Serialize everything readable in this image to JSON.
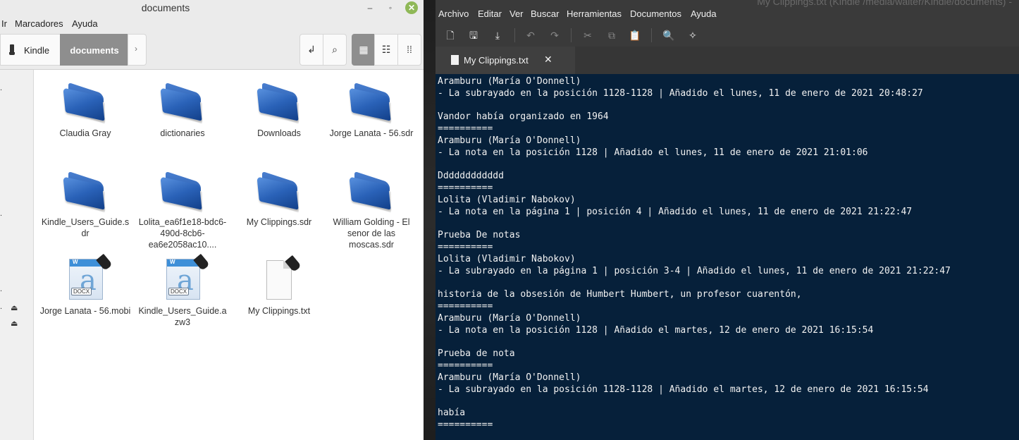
{
  "file_manager": {
    "window_title": "documents",
    "window_controls": {
      "minimize": "‒",
      "maximize": "◦",
      "close": "✕"
    },
    "menu": [
      "Ir",
      "Marcadores",
      "Ayuda"
    ],
    "breadcrumb": {
      "device": "Kindle",
      "current": "documents",
      "next": "›"
    },
    "toolbar": {
      "path_toggle": "↲",
      "search": "⌕",
      "view_icons": "▦",
      "view_compact": "☷",
      "view_list": "⁞⁞"
    },
    "sidebar_marks": [
      ".",
      ".",
      ".",
      ".",
      "⏏",
      "⏏"
    ],
    "files": [
      {
        "name": "Claudia Gray",
        "type": "folder"
      },
      {
        "name": "dictionaries",
        "type": "folder"
      },
      {
        "name": "Downloads",
        "type": "folder"
      },
      {
        "name": "Jorge Lanata - 56.sdr",
        "type": "folder"
      },
      {
        "name": "Kindle_Users_Guide.sdr",
        "type": "folder"
      },
      {
        "name": "Lolita_ea6f1e18-bdc6-490d-8cb6-ea6e2058ac10....",
        "type": "folder"
      },
      {
        "name": "My Clippings.sdr",
        "type": "folder"
      },
      {
        "name": "William Golding - El senor de las moscas.sdr",
        "type": "folder"
      },
      {
        "name": "Jorge Lanata - 56.mobi",
        "type": "word"
      },
      {
        "name": "Kindle_Users_Guide.azw3",
        "type": "word"
      },
      {
        "name": "My Clippings.txt",
        "type": "text"
      }
    ],
    "word_icon": {
      "letter": "a",
      "header": "W",
      "badge": "DOCX"
    }
  },
  "editor": {
    "window_title": "My Clippings.txt (Kindle /media/walter/Kindle/documents) -",
    "menu": [
      "Archivo",
      "Editar",
      "Ver",
      "Buscar",
      "Herramientas",
      "Documentos",
      "Ayuda"
    ],
    "toolbar_icons": [
      "new-document-icon",
      "save-icon",
      "download-icon",
      "undo-icon",
      "redo-icon",
      "cut-icon",
      "copy-icon",
      "paste-icon",
      "search-icon",
      "replace-icon"
    ],
    "toolbar_glyphs": [
      "🗋",
      "🖫",
      "⤓",
      "↶",
      "↷",
      "✂",
      "⧉",
      "📋",
      "🔍",
      "✧"
    ],
    "tab": {
      "label": "My Clippings.txt",
      "close": "✕"
    },
    "lines": [
      "Aramburu (María O'Donnell)",
      "- La subrayado en la posición 1128-1128 | Añadido el lunes, 11 de enero de 2021 20:48:27",
      "",
      "Vandor había organizado en 1964",
      "==========",
      "Aramburu (María O'Donnell)",
      "- La nota en la posición 1128 | Añadido el lunes, 11 de enero de 2021 21:01:06",
      "",
      "Dddddddddddd",
      "==========",
      "Lolita (Vladimir Nabokov)",
      "- La nota en la página 1 | posición 4 | Añadido el lunes, 11 de enero de 2021 21:22:47",
      "",
      "Prueba De notas",
      "==========",
      "Lolita (Vladimir Nabokov)",
      "- La subrayado en la página 1 | posición 3-4 | Añadido el lunes, 11 de enero de 2021 21:22:47",
      "",
      "historia de la obsesión de Humbert Humbert, un profesor cuarentón,",
      "==========",
      "Aramburu (María O'Donnell)",
      "- La nota en la posición 1128 | Añadido el martes, 12 de enero de 2021 16:15:54",
      "",
      "Prueba de nota",
      "==========",
      "Aramburu (María O'Donnell)",
      "- La subrayado en la posición 1128-1128 | Añadido el martes, 12 de enero de 2021 16:15:54",
      "",
      "había",
      "=========="
    ]
  },
  "colors": {
    "editor_bg": "#06203a",
    "editor_fg": "#f2f2f2",
    "folder_blue": "#2a62b8",
    "close_green": "#8fb857"
  }
}
